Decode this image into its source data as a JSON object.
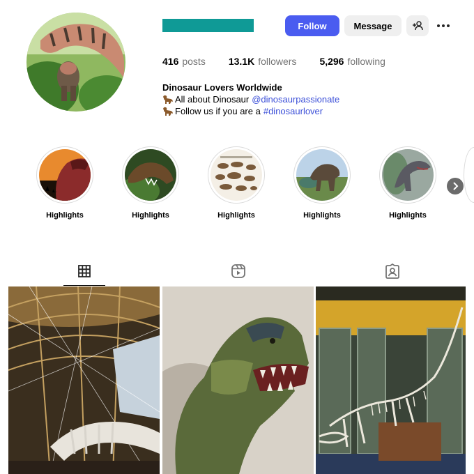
{
  "profile": {
    "follow_label": "Follow",
    "message_label": "Message",
    "stats": {
      "posts_count": "416",
      "posts_label": "posts",
      "followers_count": "13.1K",
      "followers_label": "followers",
      "following_count": "5,296",
      "following_label": "following"
    },
    "bio": {
      "name": "Dinosaur Lovers Worldwide",
      "line1_text": "All about Dinosaur",
      "line1_link": "@dinosaurpassionate",
      "line2_text": "Follow us if you are a",
      "line2_link": "#dinosaurlover"
    }
  },
  "highlights": [
    {
      "label": "Highlights"
    },
    {
      "label": "Highlights"
    },
    {
      "label": "Highlights"
    },
    {
      "label": "Highlights"
    },
    {
      "label": "Highlights"
    }
  ],
  "tabs": [
    {
      "icon": "grid-icon",
      "active": true
    },
    {
      "icon": "reels-icon",
      "active": false
    },
    {
      "icon": "tagged-icon",
      "active": false
    }
  ],
  "colors": {
    "username_bar": "#0f9a96",
    "follow_button": "#4a5cf0",
    "link": "#3b4fd8",
    "secondary_button": "#efefef"
  }
}
